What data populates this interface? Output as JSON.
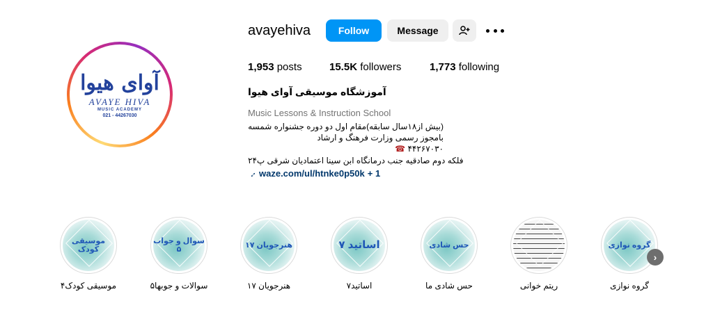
{
  "profile": {
    "username": "avayehiva",
    "follow_label": "Follow",
    "message_label": "Message",
    "add_user_icon": "person-add-icon",
    "more_icon": "more-options-icon",
    "avatar": {
      "script_text": "آوای هیوا",
      "english_name": "AVAYE HIVA",
      "subtitle": "MUSIC ACADEMY",
      "phone": "021 - 44267030"
    }
  },
  "stats": {
    "posts_count": "1,953",
    "posts_label": "posts",
    "followers_count": "15.5K",
    "followers_label": "followers",
    "following_count": "1,773",
    "following_label": "following"
  },
  "bio": {
    "full_name": "آموزشگاه موسیقی آوای هیوا",
    "category": "Music Lessons & Instruction School",
    "line1": "(بیش از۱۸سال سابقه)مقام اول دو دوره جشنواره شمسه",
    "line2": "بامجوز رسمی وزارت فرهنگ و ارشاد",
    "line3": "۴۴۲۶۷۰۳۰",
    "line4": "فلکه دوم صادقیه جنب درمانگاه ابن سینا اعتمادیان شرقی پ۲۴",
    "link_text": "waze.com/ul/htnke0p50k",
    "link_extra": "+ 1"
  },
  "highlights": [
    {
      "label": "گروه نوازی",
      "cover_text": "گروه نوازی"
    },
    {
      "label": "ریتم خوانی",
      "cover_text": ""
    },
    {
      "label": "حس شادی ما",
      "cover_text": "حس شادی"
    },
    {
      "label": "اساتید۷",
      "cover_text": "اساتید ۷"
    },
    {
      "label": "هنرجویان ۱۷",
      "cover_text": "هنرجویان ۱۷"
    },
    {
      "label": "سوالات و جوبها۵",
      "cover_text": "سوال و جواب ۵"
    },
    {
      "label": "موسیقی کودک۴",
      "cover_text": "موسیقی کودک"
    }
  ],
  "nav": {
    "next_icon": "chevron-right-icon"
  },
  "colors": {
    "accent": "#0095f6",
    "link": "#00376b",
    "highlight_text": "#1f57b7"
  }
}
